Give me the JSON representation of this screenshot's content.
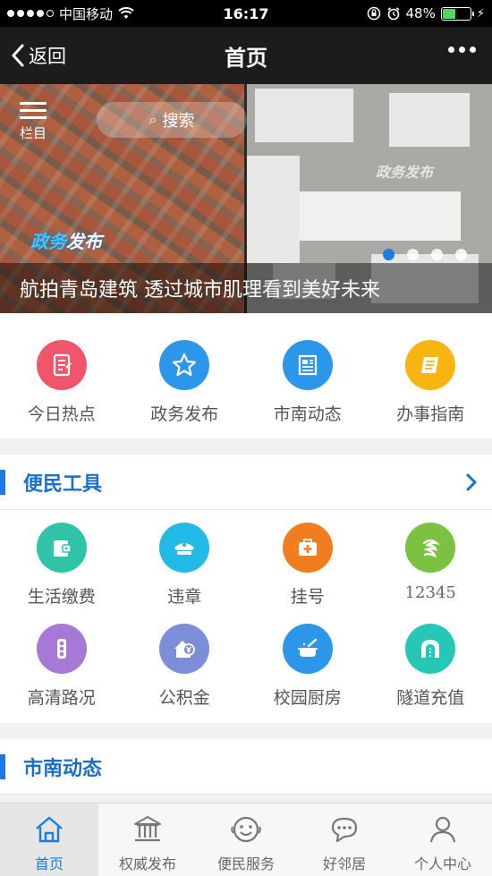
{
  "status_bar": {
    "carrier": "中国移动",
    "time": "16:17",
    "battery_text": "48%",
    "battery_level": 0.48
  },
  "nav": {
    "back_label": "返回",
    "title": "首页"
  },
  "banner": {
    "menu_label": "栏目",
    "search_label": "搜索",
    "logo_text_1": "政务",
    "logo_text_2": "发布",
    "caption": "航拍青岛建筑 透过城市肌理看到美好未来",
    "slide_count": 4,
    "active_slide": 1
  },
  "quick_links": [
    {
      "label": "今日热点",
      "icon": "hot-news-icon",
      "color": "#f0566b"
    },
    {
      "label": "政务发布",
      "icon": "star-icon",
      "color": "#2c97ea"
    },
    {
      "label": "市南动态",
      "icon": "newspaper-icon",
      "color": "#2c97ea"
    },
    {
      "label": "办事指南",
      "icon": "guide-scroll-icon",
      "color": "#f8b40f"
    }
  ],
  "tools_section": {
    "title": "便民工具"
  },
  "tools": [
    {
      "label": "生活缴费",
      "icon": "wallet-icon",
      "color": "#2fc3a7"
    },
    {
      "label": "违章",
      "icon": "police-cap-icon",
      "color": "#23b9e7"
    },
    {
      "label": "挂号",
      "icon": "medical-kit-icon",
      "color": "#f07d1e"
    },
    {
      "label": "12345",
      "icon": "hotline-logo-icon",
      "color": "#7cc242"
    },
    {
      "label": "高清路况",
      "icon": "traffic-light-icon",
      "color": "#a779d6"
    },
    {
      "label": "公积金",
      "icon": "housing-fund-icon",
      "color": "#7d8ed8"
    },
    {
      "label": "校园厨房",
      "icon": "cooking-pot-icon",
      "color": "#2c97ea"
    },
    {
      "label": "隧道充值",
      "icon": "tunnel-icon",
      "color": "#26c7b4"
    }
  ],
  "news_section": {
    "title": "市南动态"
  },
  "tab_bar": [
    {
      "label": "首页",
      "icon": "home-icon"
    },
    {
      "label": "权威发布",
      "icon": "government-building-icon"
    },
    {
      "label": "便民服务",
      "icon": "smile-face-icon"
    },
    {
      "label": "好邻居",
      "icon": "chat-bubble-icon"
    },
    {
      "label": "个人中心",
      "icon": "user-icon"
    }
  ],
  "colors": {
    "accent": "#1a7ce0",
    "nav_bg": "#1c1c1c",
    "status_bg": "#000000"
  }
}
